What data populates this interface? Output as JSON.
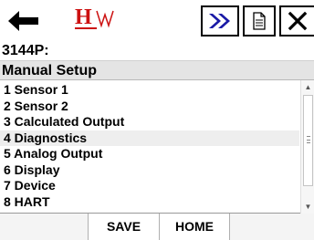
{
  "header": {
    "logo_text": "HW",
    "device_title": "3144P:",
    "menu_title": "Manual Setup"
  },
  "menu": {
    "selected_index": 3,
    "items": [
      {
        "label": "1 Sensor 1"
      },
      {
        "label": "2 Sensor 2"
      },
      {
        "label": "3 Calculated Output"
      },
      {
        "label": "4 Diagnostics"
      },
      {
        "label": "5 Analog Output"
      },
      {
        "label": "6 Display"
      },
      {
        "label": "7 Device"
      },
      {
        "label": "8 HART"
      }
    ]
  },
  "footer": {
    "save_label": "SAVE",
    "home_label": "HOME"
  },
  "colors": {
    "logo_red": "#cc1111",
    "forward_blue": "#1a1aa6"
  },
  "icons": {
    "back": "back-arrow-icon",
    "forward": "double-chevron-right-icon",
    "document": "document-icon",
    "close": "close-icon"
  }
}
